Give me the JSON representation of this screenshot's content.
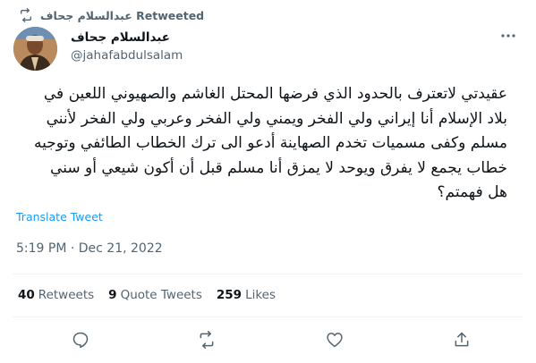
{
  "retweet": {
    "label": "عبدالسلام جحاف Retweeted",
    "icon": "retweet-icon"
  },
  "author": {
    "display_name": "عبدالسلام جحاف",
    "handle": "@jahafabdulsalam",
    "avatar": "avatar"
  },
  "tweet": {
    "text": "عقيدتي لاتعترف بالحدود الذي فرضها المحتل الغاشم والصهيوني اللعين في\nبلاد الإسلام أنا إيراني ولي الفخر ويمني ولي الفخر وعربي ولي الفخر لأنني\nمسلم وكفى مسميات تخدم الصهاينة أدعو الى ترك الخطاب الطائفي وتوجيه\nخطاب يجمع لا يفرق ويوحد لا يمزق أنا مسلم قبل أن أكون شيعي أو سني\nهل فهمتم؟",
    "translate_label": "Translate Tweet",
    "timestamp": "5:19 PM · Dec 21, 2022"
  },
  "stats": {
    "retweets_count": "40",
    "retweets_label": "Retweets",
    "quotes_count": "9",
    "quotes_label": "Quote Tweets",
    "likes_count": "259",
    "likes_label": "Likes"
  },
  "actions": [
    "reply-icon",
    "retweet-icon",
    "like-icon",
    "share-icon"
  ],
  "colors": {
    "accent": "#1d9bf0",
    "text": "#0f1419",
    "secondary": "#536471",
    "divider": "#eff3f4"
  }
}
